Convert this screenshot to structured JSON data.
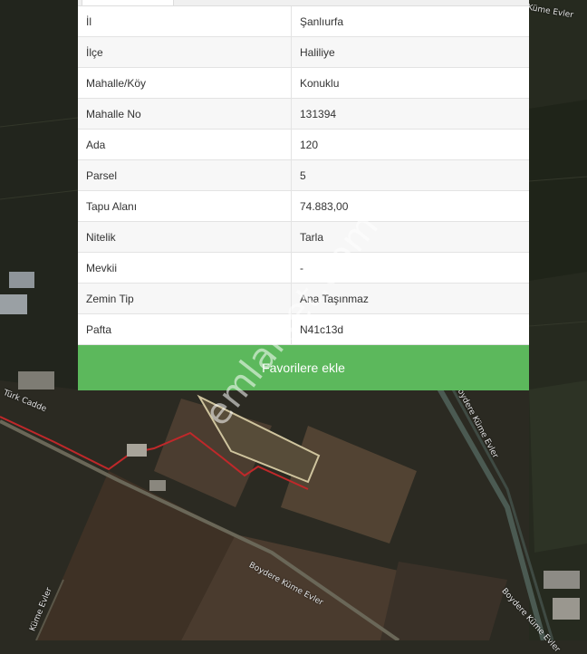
{
  "parcel_info": {
    "rows": [
      {
        "key": "İl",
        "value": "Şanlıurfa"
      },
      {
        "key": "İlçe",
        "value": "Haliliye"
      },
      {
        "key": "Mahalle/Köy",
        "value": "Konuklu"
      },
      {
        "key": "Mahalle No",
        "value": "131394"
      },
      {
        "key": "Ada",
        "value": "120"
      },
      {
        "key": "Parsel",
        "value": "5"
      },
      {
        "key": "Tapu Alanı",
        "value": "74.883,00"
      },
      {
        "key": "Nitelik",
        "value": "Tarla"
      },
      {
        "key": "Mevkii",
        "value": "-"
      },
      {
        "key": "Zemin Tip",
        "value": "Ana Taşınmaz"
      },
      {
        "key": "Pafta",
        "value": "N41c13d"
      }
    ],
    "favorite_label": "Favorilere ekle"
  },
  "watermark": "emlakjet.com",
  "map": {
    "labels": {
      "street_1": "Türk Cadde",
      "street_2": "Boydere Küme Evler",
      "street_3": "Boydere Küme Evler",
      "street_4": "Küme Evler",
      "street_5": "Boydere Küme Evler",
      "street_6": "Küme Evler"
    }
  },
  "colors": {
    "button": "#5cb85c",
    "parcel_outline": "#c0282a",
    "satellite_base": "#2a2a22"
  }
}
